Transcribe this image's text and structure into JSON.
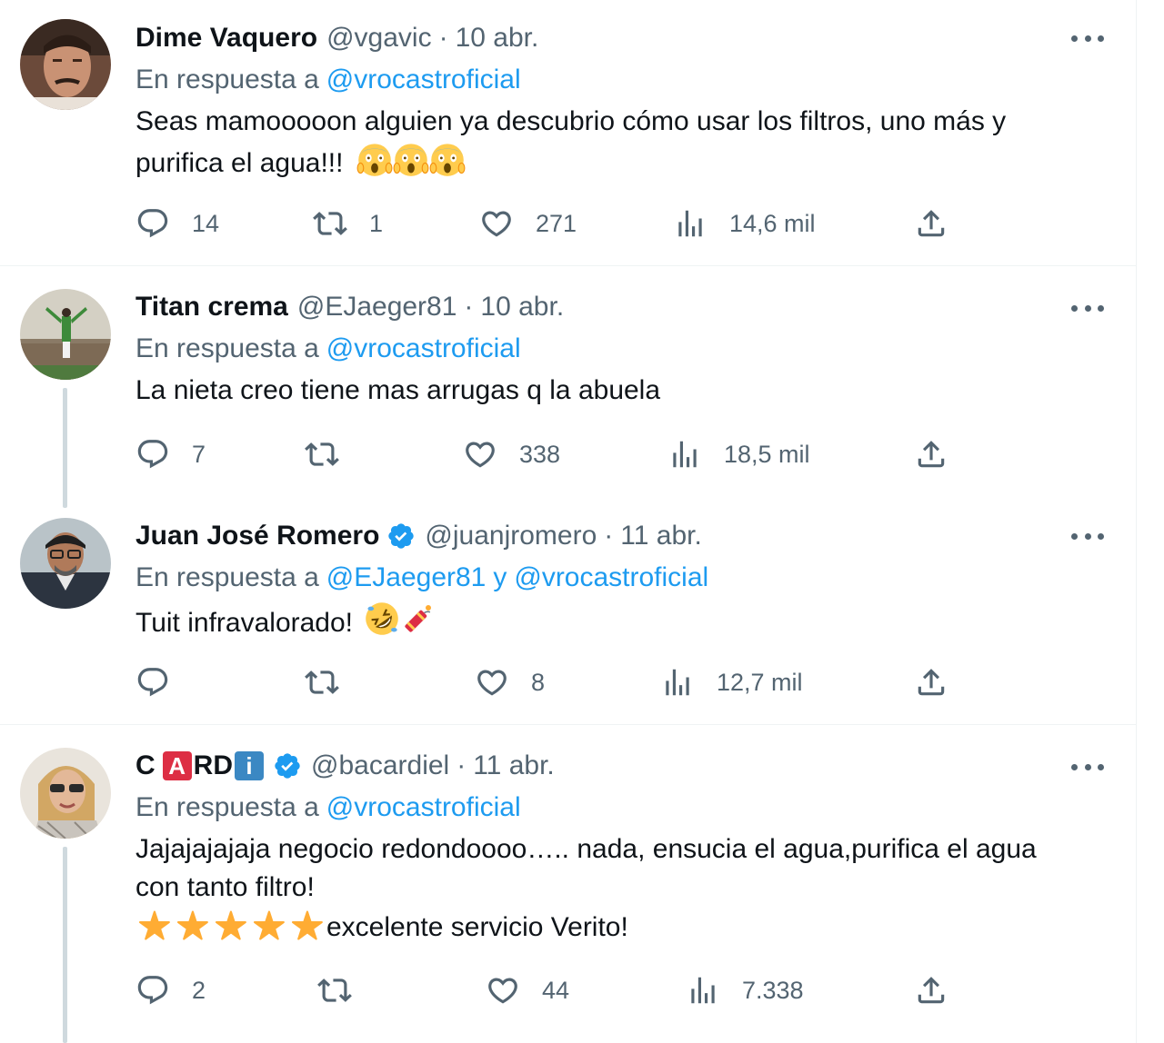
{
  "tweets": [
    {
      "name": "Dime Vaquero",
      "handle": "@vgavic",
      "separator": "·",
      "date": "10 abr.",
      "reply_prefix": "En respuesta a",
      "reply_mentions": [
        "@vrocastroficial"
      ],
      "text_lines": [
        "Seas mamooooon alguien ya descubrio cómo usar los filtros, uno más y",
        "purifica el agua!!!"
      ],
      "emoji": [
        "face-screaming-in-fear-icon",
        "face-screaming-in-fear-icon",
        "face-screaming-in-fear-icon"
      ],
      "stats": {
        "replies": "14",
        "retweets": "1",
        "likes": "271",
        "views": "14,6 mil"
      }
    },
    {
      "name": "Titan crema",
      "handle": "@EJaeger81",
      "separator": "·",
      "date": "10 abr.",
      "reply_prefix": "En respuesta a",
      "reply_mentions": [
        "@vrocastroficial"
      ],
      "text_lines": [
        "La nieta creo tiene mas arrugas q la abuela"
      ],
      "stats": {
        "replies": "7",
        "retweets": "",
        "likes": "338",
        "views": "18,5 mil"
      }
    },
    {
      "name": "Juan José Romero",
      "verified": true,
      "handle": "@juanjromero",
      "separator": "·",
      "date": "11 abr.",
      "reply_prefix": "En respuesta a",
      "reply_mentions": [
        "@EJaeger81",
        "@vrocastroficial"
      ],
      "reply_conjunction": "y",
      "text_lines": [
        "Tuit infravalorado!"
      ],
      "emoji": [
        "rolling-on-floor-laughing-icon",
        "firecracker-icon"
      ],
      "stats": {
        "replies": "",
        "retweets": "",
        "likes": "8",
        "views": "12,7 mil"
      }
    },
    {
      "name_parts": [
        "C",
        "A",
        "RD",
        "i"
      ],
      "verified": true,
      "handle": "@bacardiel",
      "separator": "·",
      "date": "11 abr.",
      "reply_prefix": "En respuesta a",
      "reply_mentions": [
        "@vrocastroficial"
      ],
      "text_lines": [
        "Jajajajajaja negocio redondoooo….. nada, ensucia el agua,purifica el agua",
        "con tanto filtro!",
        "excelente servicio Verito!"
      ],
      "emoji": [
        "star-icon",
        "star-icon",
        "star-icon",
        "star-icon",
        "star-icon"
      ],
      "stats": {
        "replies": "2",
        "retweets": "",
        "likes": "44",
        "views": "7.338"
      }
    }
  ],
  "colors": {
    "text": "#0f1419",
    "secondary": "#536471",
    "link": "#1d9bf0",
    "divider": "#eff3f4",
    "thread_line": "#cfd9de",
    "verified": "#1d9bf0"
  }
}
